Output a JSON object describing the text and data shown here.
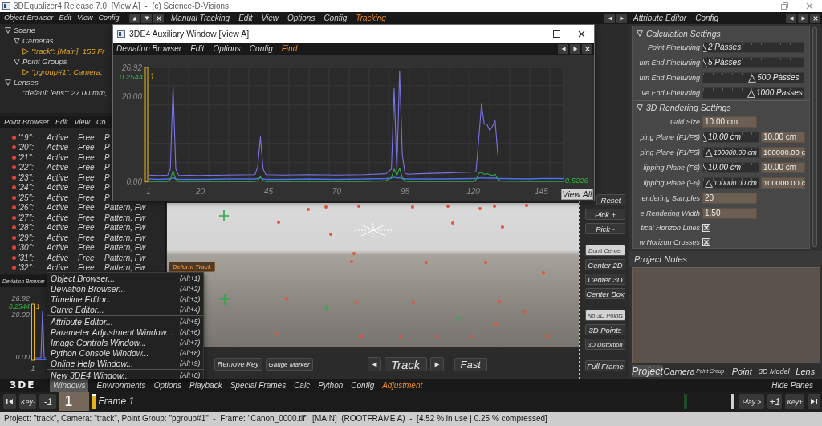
{
  "window": {
    "title": "3DEqualizer4 Release 7.0, [View A]  -  (c) Science-D-Visions"
  },
  "object_browser": {
    "menu": [
      {
        "label": "Object Browser"
      },
      {
        "label": "Edit"
      },
      {
        "label": "View"
      },
      {
        "label": "Config"
      }
    ],
    "tree": [
      {
        "label": "Scene",
        "expanded": true,
        "children": [
          {
            "label": "Cameras",
            "expanded": true,
            "children": [
              {
                "label": "\"track\": [Main], 155 Fr",
                "expanded": false,
                "highlighted": true
              }
            ]
          },
          {
            "label": "Point Groups",
            "expanded": true,
            "children": [
              {
                "label": "\"pgroup#1\": Camera,",
                "expanded": false,
                "highlighted": true
              }
            ]
          }
        ]
      },
      {
        "label": "Lenses",
        "expanded": true,
        "children": [
          {
            "label": "\"default lens\": 27.00 mm,",
            "highlighted": false
          }
        ]
      }
    ]
  },
  "point_browser": {
    "menu": [
      {
        "label": "Point Browser"
      },
      {
        "label": "Edit"
      },
      {
        "label": "View"
      },
      {
        "label": "Co"
      }
    ],
    "rows": [
      {
        "name": "\"19\":",
        "status": "Active",
        "mode": "Free",
        "type": "P"
      },
      {
        "name": "\"20\":",
        "status": "Active",
        "mode": "Free",
        "type": "P"
      },
      {
        "name": "\"21\":",
        "status": "Active",
        "mode": "Free",
        "type": "P"
      },
      {
        "name": "\"22\":",
        "status": "Active",
        "mode": "Free",
        "type": "P"
      },
      {
        "name": "\"23\":",
        "status": "Active",
        "mode": "Free",
        "type": "P"
      },
      {
        "name": "\"24\":",
        "status": "Active",
        "mode": "Free",
        "type": "P"
      },
      {
        "name": "\"25\":",
        "status": "Active",
        "mode": "Free",
        "type": "P"
      },
      {
        "name": "\"26\":",
        "status": "Active",
        "mode": "Free",
        "type": "Pattern, Fw"
      },
      {
        "name": "\"27\":",
        "status": "Active",
        "mode": "Free",
        "type": "Pattern, Fw"
      },
      {
        "name": "\"28\":",
        "status": "Active",
        "mode": "Free",
        "type": "Pattern, Fw"
      },
      {
        "name": "\"29\":",
        "status": "Active",
        "mode": "Free",
        "type": "Pattern, Fw"
      },
      {
        "name": "\"30\":",
        "status": "Active",
        "mode": "Free",
        "type": "Pattern, Fw"
      },
      {
        "name": "\"31\":",
        "status": "Active",
        "mode": "Free",
        "type": "Pattern, Fw"
      },
      {
        "name": "\"32\":",
        "status": "Active",
        "mode": "Free",
        "type": "Pattern, Fw"
      }
    ]
  },
  "deviation_mini": {
    "title": "Deviation Browser",
    "y_labels": [
      "26.92",
      "20.00",
      "0.00"
    ],
    "current_value": "0.2544",
    "current_frame": "1",
    "x_label": "1"
  },
  "manual_tracking": {
    "menu": [
      {
        "label": "Manual Tracking",
        "accent": false
      },
      {
        "label": "Edit",
        "accent": false
      },
      {
        "label": "View",
        "accent": false
      },
      {
        "label": "Options",
        "accent": false
      },
      {
        "label": "Config",
        "accent": false
      },
      {
        "label": "Tracking",
        "accent": true
      }
    ]
  },
  "aux_window": {
    "title": "3DE4 Auxiliary Window [View A]",
    "menu": [
      {
        "label": "Deviation Browser",
        "accent": false
      },
      {
        "label": "Edit",
        "accent": false
      },
      {
        "label": "Options",
        "accent": false
      },
      {
        "label": "Config",
        "accent": false
      },
      {
        "label": "Find",
        "accent": true
      }
    ],
    "current_value": "0.2544",
    "end_value": "0.5226",
    "view_all": "View All",
    "chart_data": {
      "type": "line",
      "xlim": [
        1,
        153
      ],
      "ylim": [
        0,
        26.92
      ],
      "xticks": [
        1,
        20,
        45,
        70,
        95,
        120,
        145
      ],
      "yticks": [
        {
          "value": 0,
          "label": "0.00"
        },
        {
          "value": 20,
          "label": "20.00"
        },
        {
          "value": 26.92,
          "label": "26.92"
        }
      ],
      "annotations": [
        "1"
      ],
      "x": [
        1,
        5,
        8,
        9,
        10,
        11,
        12,
        20,
        30,
        40,
        41,
        42,
        43,
        44,
        50,
        60,
        70,
        80,
        88,
        90,
        91,
        92,
        93,
        94,
        95,
        96,
        100,
        110,
        120,
        121,
        122,
        123,
        124,
        125,
        126,
        127,
        128,
        129,
        130,
        140,
        145,
        150,
        153
      ],
      "series": [
        {
          "color": "#7b74e4",
          "values": [
            1.6,
            1.5,
            1.6,
            3,
            22.5,
            3,
            1.6,
            1.5,
            1.6,
            1.7,
            3.5,
            10.6,
            3,
            1.7,
            1.6,
            1.7,
            1.6,
            1.7,
            1.9,
            3,
            21.9,
            2.5,
            26,
            6.3,
            2,
            1.8,
            1.9,
            2.1,
            2.3,
            2.4,
            10,
            18.3,
            13.6,
            13.6,
            12.1,
            13,
            14.4,
            6.3,
            null,
            null,
            null,
            null,
            null
          ]
        },
        {
          "color": "#4d6ef0",
          "values": [
            0.7,
            0.6,
            0.7,
            0.7,
            1,
            0.7,
            0.6,
            0.6,
            0.7,
            0.7,
            0.8,
            1,
            0.7,
            0.6,
            0.6,
            0.7,
            0.6,
            0.7,
            0.8,
            0.9,
            1.1,
            0.9,
            1,
            0.8,
            0.7,
            0.7,
            0.7,
            0.7,
            0.8,
            0.8,
            0.9,
            1,
            0.9,
            0.9,
            0.9,
            0.9,
            0.9,
            0.8,
            0.8,
            0.7,
            0.8,
            0.8,
            0.8
          ]
        },
        {
          "color": "#34a844",
          "values": [
            0.1,
            0.1,
            0.1,
            0.6,
            2.6,
            0.6,
            0.1,
            0.1,
            0.1,
            0.1,
            0.3,
            1.2,
            0.3,
            0.1,
            0.1,
            0.1,
            0.1,
            0.1,
            0.3,
            1,
            3,
            1.5,
            3.2,
            1,
            0.2,
            0.1,
            0.1,
            0.1,
            0.1,
            0.5,
            2,
            2.2,
            1.8,
            1.9,
            1.7,
            1.5,
            1.8,
            0.6,
            0.2,
            0.1,
            0.1,
            0.1,
            0.1
          ]
        }
      ]
    }
  },
  "viewport": {
    "tool_button": "Deform Track",
    "edit_buttons": [
      "Remove Key",
      "Gauge Marker"
    ],
    "track_button": "Track",
    "speed_button": "Fast",
    "side_buttons": [
      [
        {
          "label": "Reset"
        },
        {
          "label": "Pick +"
        },
        {
          "label": "Pick -"
        }
      ],
      [
        {
          "label": "Don't Center",
          "selected": true
        },
        {
          "label": "Center 2D",
          "selected": false
        },
        {
          "label": "Center 3D",
          "selected": false
        },
        {
          "label": "Center Box",
          "selected": false
        }
      ],
      [
        {
          "label": "No 3D Points",
          "selected": true
        },
        {
          "label": "3D Points",
          "selected": false
        },
        {
          "label": "3D Distortion",
          "selected": false
        }
      ],
      [
        {
          "label": "Full Frame"
        }
      ]
    ]
  },
  "attribute_editor": {
    "menu": [
      {
        "label": "Attribute Editor"
      },
      {
        "label": "Config"
      }
    ],
    "sections": [
      {
        "title": "Calculation Settings",
        "expanded": true,
        "rows": [
          {
            "kind": "slider",
            "label": "Point Finetuning",
            "value": "2 Passes",
            "level": 0
          },
          {
            "kind": "slider",
            "label": "um End Finetuning",
            "value": "5 Passes",
            "level": 0
          },
          {
            "kind": "slider",
            "label": "um End Finetuning",
            "value": "500 Passes",
            "level": 0.49
          },
          {
            "kind": "slider",
            "label": "ve End Finetuning",
            "value": "1000 Passes",
            "level": 0.48
          }
        ]
      },
      {
        "title": "3D Rendering Settings",
        "expanded": true,
        "rows": [
          {
            "kind": "field",
            "label": "Grid Size",
            "value": "10.00 cm"
          },
          {
            "kind": "slider_field",
            "label": "ping Plane (F1/F5)",
            "value": "10.00 cm",
            "level": 0,
            "field": "10.00 cm"
          },
          {
            "kind": "slider_field",
            "label": "ping Plane (F1/F5)",
            "value": "100000.00 cm",
            "level": 0.1,
            "field": "100000.00 c"
          },
          {
            "kind": "slider_field",
            "label": "lipping Plane (F6)",
            "value": "10.00 cm",
            "level": 0,
            "field": "10.00 cm"
          },
          {
            "kind": "slider_field",
            "label": "lipping Plane (F6)",
            "value": "100000.00 cm",
            "level": 0.1,
            "field": "100000.00 c"
          },
          {
            "kind": "field",
            "label": "endering Samples",
            "value": "20"
          },
          {
            "kind": "field",
            "label": "e Rendering Width",
            "value": "1.50"
          },
          {
            "kind": "checkbox",
            "label": "tical Horizon Lines",
            "checked": true
          },
          {
            "kind": "checkbox",
            "label": "w Horizon Crosses",
            "checked": true
          }
        ]
      }
    ]
  },
  "project_notes": {
    "title": "Project Notes"
  },
  "tabs": [
    {
      "label": "Project",
      "selected": true
    },
    {
      "label": "Camera",
      "selected": false
    },
    {
      "label": "Point Group",
      "selected": false
    },
    {
      "label": "Point",
      "selected": false
    },
    {
      "label": "3D Model",
      "selected": false
    },
    {
      "label": "Lens",
      "selected": false
    }
  ],
  "windows_menu": {
    "sections": [
      {
        "items": [
          {
            "label": "Object Browser...",
            "shortcut": "(Alt+1)"
          },
          {
            "label": "Deviation Browser...",
            "shortcut": "(Alt+2)"
          },
          {
            "label": "Timeline Editor...",
            "shortcut": "(Alt+3)"
          },
          {
            "label": "Curve Editor...",
            "shortcut": "(Alt+4)"
          }
        ]
      },
      {
        "items": [
          {
            "label": "Attribute Editor...",
            "shortcut": "(Alt+5)"
          },
          {
            "label": "Parameter Adjustment Window...",
            "shortcut": "(Alt+6)"
          },
          {
            "label": "Image Controls Window...",
            "shortcut": "(Alt+7)"
          },
          {
            "label": "Python Console Window...",
            "shortcut": "(Alt+8)"
          },
          {
            "label": "Online Help Window...",
            "shortcut": "(Alt+9)"
          }
        ]
      },
      {
        "items": [
          {
            "label": "New 3DE4 Window...",
            "shortcut": "(Alt+0)"
          }
        ]
      }
    ]
  },
  "main_menu": {
    "logo": "3DE",
    "items": [
      {
        "label": "Windows",
        "selected": true,
        "accent": false
      },
      {
        "label": "Environments",
        "selected": false,
        "accent": false
      },
      {
        "label": "Options",
        "selected": false,
        "accent": false
      },
      {
        "label": "Playback",
        "selected": false,
        "accent": false
      },
      {
        "label": "Special Frames",
        "selected": false,
        "accent": false
      },
      {
        "label": "Calc",
        "selected": false,
        "accent": false
      },
      {
        "label": "Python",
        "selected": false,
        "accent": false
      },
      {
        "label": "Config",
        "selected": false,
        "accent": false
      },
      {
        "label": "Adjustment",
        "selected": false,
        "accent": true
      }
    ],
    "hide_panes": "Hide Panes"
  },
  "timeline": {
    "left_buttons": [
      "Key-",
      "-1"
    ],
    "frame": "1",
    "level": 0,
    "frame_label": "Frame 1",
    "right_buttons": [
      "Play >",
      "+1",
      "Key+"
    ]
  },
  "status_bar": "Project: \"track\", Camera: \"track\", Point Group: \"pgroup#1\"  -  Frame: \"Canon_0000.tif\"  [MAIN]  (ROOTFRAME A)  -  [4.52 % in use | 0.25 % compressed]"
}
